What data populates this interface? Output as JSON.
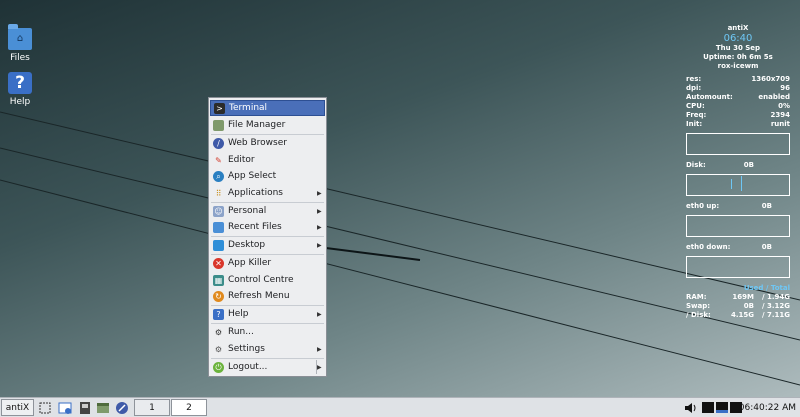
{
  "desktop": {
    "icons": [
      {
        "label": "Files",
        "icon": "folder-home-icon"
      },
      {
        "label": "Help",
        "icon": "help-icon"
      }
    ]
  },
  "conky": {
    "host": "antiX",
    "time": "06:40",
    "date": "Thu 30 Sep",
    "uptime": "Uptime: 0h 6m 5s",
    "wm": "rox-icewm",
    "info": [
      {
        "label": "res:",
        "value": "1360x709"
      },
      {
        "label": "dpi:",
        "value": "96"
      },
      {
        "label": "Automount:",
        "value": "enabled"
      },
      {
        "label": "CPU:",
        "value": "0%"
      },
      {
        "label": "Freq:",
        "value": "2394"
      },
      {
        "label": "Init:",
        "value": "runit"
      }
    ],
    "disk": {
      "label": "Disk:",
      "value": "0B"
    },
    "eth_up": {
      "label": "eth0 up:",
      "value": "0B"
    },
    "eth_down": {
      "label": "eth0 down:",
      "value": "0B"
    },
    "mem_header": "Used / Total",
    "mem": [
      {
        "label": "RAM:",
        "used": "169M",
        "total": "/ 1.94G"
      },
      {
        "label": "Swap:",
        "used": "0B",
        "total": "/ 3.12G"
      },
      {
        "label": "/ Disk:",
        "used": "4.15G",
        "total": "/ 7.11G"
      }
    ]
  },
  "menu": {
    "items": [
      {
        "label": "Terminal",
        "icon": "terminal-icon",
        "submenu": false,
        "highlighted": true
      },
      {
        "label": "File Manager",
        "icon": "file-manager-icon",
        "submenu": false
      },
      {
        "label": "Web Browser",
        "icon": "web-browser-icon",
        "submenu": false
      },
      {
        "label": "Editor",
        "icon": "editor-icon",
        "submenu": false
      },
      {
        "label": "App Select",
        "icon": "app-select-icon",
        "submenu": false
      },
      {
        "label": "Applications",
        "icon": "applications-icon",
        "submenu": true
      },
      {
        "label": "Personal",
        "icon": "personal-icon",
        "submenu": true
      },
      {
        "label": "Recent Files",
        "icon": "recent-files-icon",
        "submenu": true
      },
      {
        "label": "Desktop",
        "icon": "desktop-icon",
        "submenu": true
      },
      {
        "label": "App Killer",
        "icon": "app-killer-icon",
        "submenu": false
      },
      {
        "label": "Control Centre",
        "icon": "control-centre-icon",
        "submenu": false
      },
      {
        "label": "Refresh Menu",
        "icon": "refresh-menu-icon",
        "submenu": false
      },
      {
        "label": "Help",
        "icon": "help-icon",
        "submenu": true
      },
      {
        "label": "Run...",
        "icon": "run-icon",
        "submenu": false
      },
      {
        "label": "Settings",
        "icon": "settings-icon",
        "submenu": true
      },
      {
        "label": "Logout...",
        "icon": "logout-icon",
        "submenu": true
      }
    ]
  },
  "taskbar": {
    "start_label": "antiX",
    "workspaces": [
      "1",
      "2"
    ],
    "active_workspace": "2",
    "clock": "06:40:22 AM"
  },
  "colors": {
    "menu_highlight": "#4a6fb9",
    "conky_accent": "#6ec7f5"
  }
}
